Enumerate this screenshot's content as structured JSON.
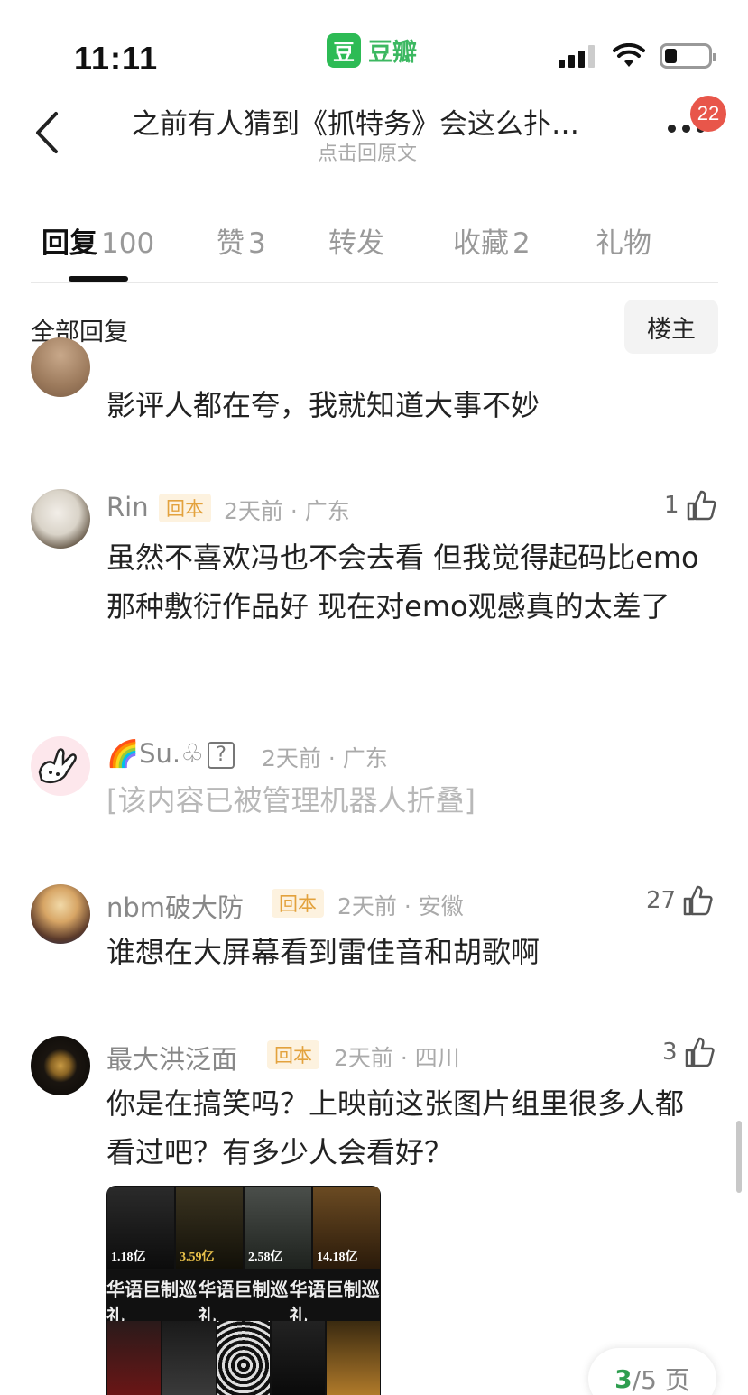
{
  "status_bar": {
    "time": "11:11",
    "app_logo_char": "豆",
    "app_name": "豆瓣",
    "icons": [
      "cellular-signal",
      "wifi",
      "battery-low"
    ]
  },
  "header": {
    "title": "之前有人猜到《抓特务》会这么扑…",
    "subtitle": "点击回原文",
    "notification_count": "22"
  },
  "tabs": [
    {
      "label": "回复",
      "count": "100",
      "active": true
    },
    {
      "label": "赞",
      "count": "3",
      "active": false
    },
    {
      "label": "转发",
      "count": "",
      "active": false
    },
    {
      "label": "收藏",
      "count": "2",
      "active": false
    },
    {
      "label": "礼物",
      "count": "",
      "active": false
    }
  ],
  "filter": {
    "all_replies_label": "全部回复",
    "op_only_label": "楼主"
  },
  "comments": [
    {
      "name": "",
      "content": "影评人都在夸，我就知道大事不妙"
    },
    {
      "name": "Rin",
      "author_tag": "回本",
      "meta": "2天前 · 广东",
      "likes": "1",
      "content": "虽然不喜欢冯也不会去看 但我觉得起码比emo那种敷衍作品好 现在对emo观感真的太差了"
    },
    {
      "name_prefix": "🌈",
      "name": "Su.♧",
      "name_suffix": "?",
      "meta": "2天前 · 广东",
      "content": "[该内容已被管理机器人折叠]"
    },
    {
      "name": "nbm破大防",
      "author_tag": "回本",
      "meta": "2天前 · 安徽",
      "likes": "27",
      "content": "谁想在大屏幕看到雷佳音和胡歌啊"
    },
    {
      "name": "最大洪泛面",
      "author_tag": "回本",
      "meta": "2天前 · 四川",
      "likes": "3",
      "content": "你是在搞笑吗？上映前这张图片组里很多人都看过吧？有多少人会看好？",
      "image": {
        "banner_text": [
          "华语巨制巡礼",
          "华语巨制巡礼",
          "华语巨制巡礼"
        ],
        "poster_amounts": [
          "1.18亿",
          "3.59亿",
          "2.58亿",
          "14.18亿"
        ]
      }
    }
  ],
  "pagination": {
    "current": "3",
    "total_text": "/5 页"
  },
  "colors": {
    "brand_green": "#2dbb55",
    "badge_red": "#e8564a",
    "author_tag_bg": "#fdf2df",
    "author_tag_text": "#e3a23d",
    "page_current": "#2e9e4f"
  }
}
